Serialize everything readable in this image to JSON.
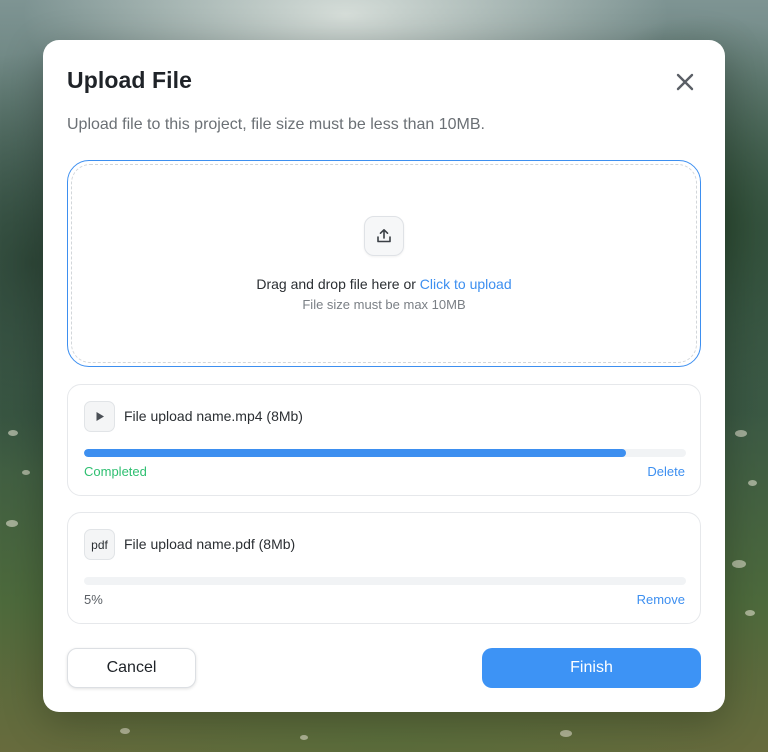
{
  "dialog": {
    "title": "Upload File",
    "subtitle": "Upload file to this project, file size must be less than 10MB.",
    "close_icon": "close-icon"
  },
  "dropzone": {
    "icon": "upload-icon",
    "text_prefix": "Drag and drop file here or ",
    "link_text": "Click to upload",
    "hint": "File size must be max 10MB",
    "accent_color": "#3d8ff0"
  },
  "files": [
    {
      "icon": "play-icon",
      "name": "File upload name.mp4 (8Mb)",
      "progress": 0.9,
      "status": "Completed",
      "status_color": "#2fbf71",
      "action": "Delete"
    },
    {
      "icon": "pdf-file-icon",
      "icon_text": "pdf",
      "name": "File upload name.pdf (8Mb)",
      "progress": 0.05,
      "status": "5%",
      "status_color": "#5b6066",
      "action": "Remove"
    }
  ],
  "footer": {
    "cancel_label": "Cancel",
    "finish_label": "Finish",
    "finish_color": "#3d93f5"
  }
}
